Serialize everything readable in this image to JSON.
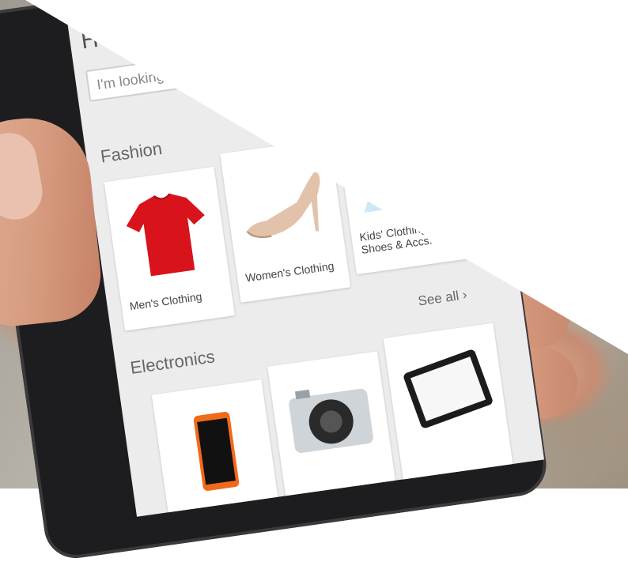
{
  "screen": {
    "header_title": "Ho",
    "search_placeholder": "I'm looking f"
  },
  "fashion": {
    "title": "Fashion",
    "items": [
      {
        "label": "Men's Clothing",
        "icon": "red-tshirt-icon"
      },
      {
        "label": "Women's Clothing",
        "icon": "beige-heel-shoe-icon"
      },
      {
        "label": "Kids' Clothing, Shoes & Accs.",
        "icon": "blue-floral-dress-icon"
      }
    ]
  },
  "electronics": {
    "title": "Electronics",
    "see_all": "See all",
    "see_all_icon": "chevron-right-icon",
    "items": [
      {
        "icon": "smartphone-icon"
      },
      {
        "icon": "camera-icon"
      },
      {
        "icon": "tablet-icon"
      }
    ]
  },
  "colors": {
    "accent_red": "#d8131b",
    "shoe_beige": "#e2c2aa",
    "dress_blue": "#8fc3e8"
  }
}
